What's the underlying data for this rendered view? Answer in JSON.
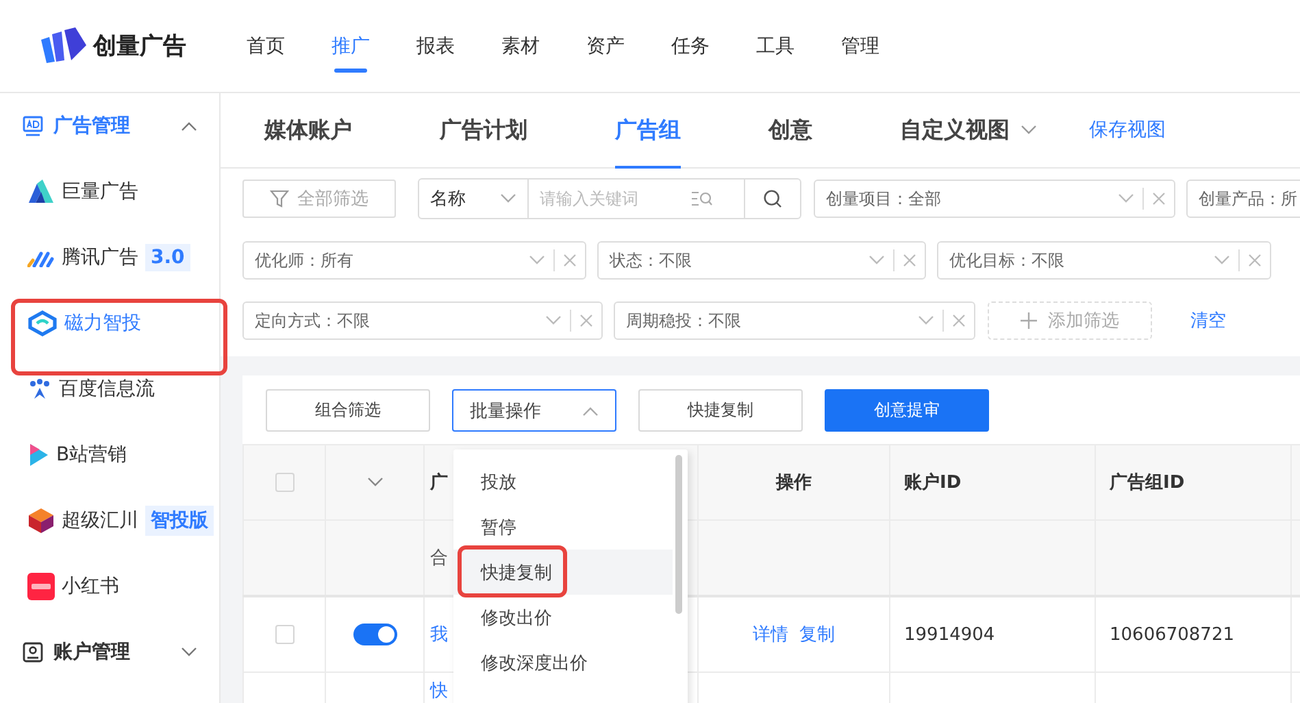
{
  "header": {
    "logo": "创量广告",
    "nav": [
      {
        "label": "首页",
        "selected": false
      },
      {
        "label": "推广",
        "selected": true
      },
      {
        "label": "报表",
        "selected": false
      },
      {
        "label": "素材",
        "selected": false
      },
      {
        "label": "资产",
        "selected": false
      },
      {
        "label": "任务",
        "selected": false
      },
      {
        "label": "工具",
        "selected": false
      },
      {
        "label": "管理",
        "selected": false
      }
    ]
  },
  "sidebar": {
    "groups": [
      {
        "label": "广告管理",
        "expanded": true,
        "items": [
          {
            "label": "巨量广告",
            "selected": false,
            "highlighted": false
          },
          {
            "label": "腾讯广告",
            "badge": "3.0",
            "selected": false,
            "highlighted": false
          },
          {
            "label": "磁力智投",
            "selected": true,
            "highlighted": true
          },
          {
            "label": "百度信息流",
            "selected": false,
            "highlighted": false
          },
          {
            "label": "B站营销",
            "selected": false,
            "highlighted": false
          },
          {
            "label": "超级汇川",
            "badge": "智投版",
            "selected": false,
            "highlighted": false
          },
          {
            "label": "小红书",
            "selected": false,
            "highlighted": false
          }
        ]
      },
      {
        "label": "账户管理",
        "expanded": false
      }
    ]
  },
  "tabs": [
    {
      "label": "媒体账户",
      "selected": false
    },
    {
      "label": "广告计划",
      "selected": false
    },
    {
      "label": "广告组",
      "selected": true
    },
    {
      "label": "创意",
      "selected": false
    },
    {
      "label": "自定义视图",
      "selected": false,
      "dropdown": true
    }
  ],
  "save_view": "保存视图",
  "filters": {
    "rows": [
      [
        {
          "kind": "all",
          "label": "全部筛选"
        },
        {
          "kind": "search",
          "select": "名称",
          "placeholder": "请输入关键词"
        },
        {
          "kind": "select",
          "label": "创量项目：全部"
        },
        {
          "kind": "select",
          "label": "创量产品：所"
        }
      ],
      [
        {
          "kind": "select",
          "label": "优化师：所有"
        },
        {
          "kind": "select",
          "label": "状态：不限"
        },
        {
          "kind": "select",
          "label": "优化目标：不限"
        }
      ],
      [
        {
          "kind": "select",
          "label": "定向方式：不限"
        },
        {
          "kind": "select",
          "label": "周期稳投：不限"
        },
        {
          "kind": "add",
          "label": "添加筛选"
        },
        {
          "kind": "link",
          "label": "清空"
        }
      ]
    ]
  },
  "toolbar": [
    {
      "label": "组合筛选",
      "kind": "default"
    },
    {
      "label": "批量操作",
      "kind": "dropdown",
      "open": true
    },
    {
      "label": "快捷复制",
      "kind": "default"
    },
    {
      "label": "创意提审",
      "kind": "primary"
    }
  ],
  "table": {
    "all_checked": false,
    "columns": [
      "广",
      "操作",
      "账户ID",
      "广告组ID"
    ],
    "summary": "合",
    "rows": [
      {
        "checked": false,
        "on": true,
        "name": "我",
        "actions": [
          "详情",
          "复制"
        ],
        "account_id": "19914904",
        "group_id": "10606708721"
      },
      {
        "name": "快"
      }
    ]
  },
  "menu": {
    "items": [
      {
        "label": "投放",
        "hovered": false,
        "highlighted": false
      },
      {
        "label": "暂停",
        "hovered": false,
        "highlighted": false
      },
      {
        "label": "快捷复制",
        "hovered": true,
        "highlighted": true
      },
      {
        "label": "修改出价",
        "hovered": false,
        "highlighted": false
      },
      {
        "label": "修改深度出价",
        "hovered": false,
        "highlighted": false
      }
    ]
  }
}
